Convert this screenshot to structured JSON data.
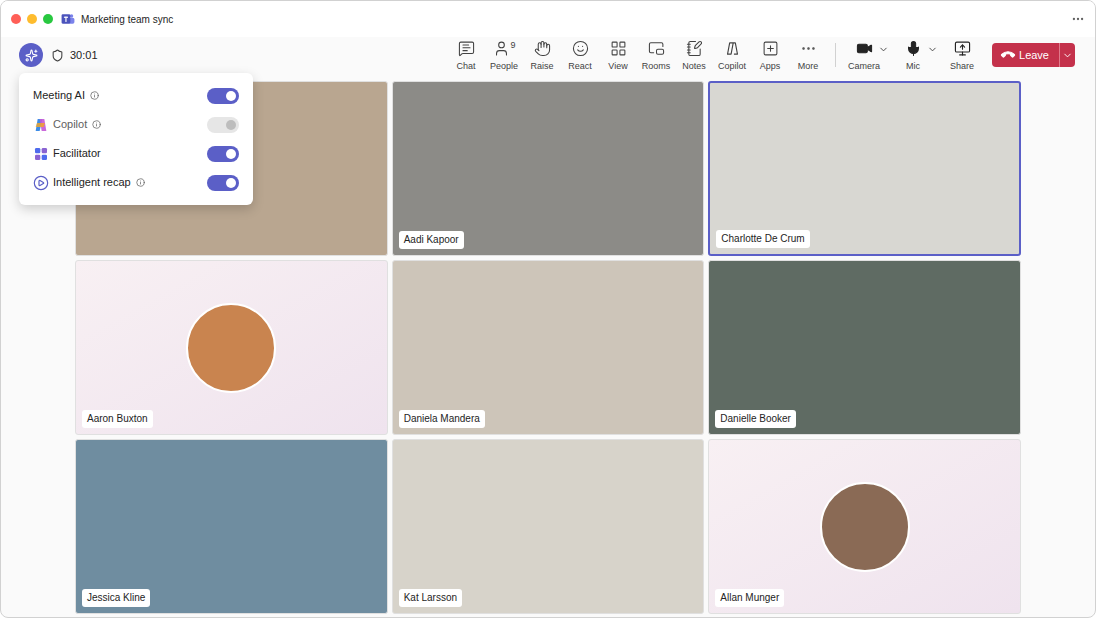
{
  "window": {
    "title": "Marketing team sync"
  },
  "meeting": {
    "timer": "30:01"
  },
  "toolbar": [
    {
      "label": "Chat"
    },
    {
      "label": "People",
      "count": "9"
    },
    {
      "label": "Raise"
    },
    {
      "label": "React"
    },
    {
      "label": "View"
    },
    {
      "label": "Rooms"
    },
    {
      "label": "Notes"
    },
    {
      "label": "Copilot"
    },
    {
      "label": "Apps"
    },
    {
      "label": "More"
    }
  ],
  "devices": [
    {
      "label": "Camera"
    },
    {
      "label": "Mic"
    }
  ],
  "share": {
    "label": "Share"
  },
  "leave": {
    "label": "Leave"
  },
  "ai_menu": [
    {
      "label": "Meeting AI",
      "info": true,
      "on": true,
      "disabled": false
    },
    {
      "label": "Copilot",
      "info": true,
      "on": true,
      "disabled": true
    },
    {
      "label": "Facilitator",
      "info": false,
      "on": true,
      "disabled": false
    },
    {
      "label": "Intelligent recap",
      "info": true,
      "on": true,
      "disabled": false
    }
  ],
  "participants": [
    {
      "name": "",
      "kind": "video",
      "speaking": false,
      "color": "#b9a690"
    },
    {
      "name": "Aadi Kapoor",
      "kind": "video",
      "speaking": false,
      "color": "#8c8b87"
    },
    {
      "name": "Charlotte De Crum",
      "kind": "video",
      "speaking": true,
      "color": "#d8d7d2"
    },
    {
      "name": "Aaron Buxton",
      "kind": "avatar",
      "speaking": false,
      "color": "#c9844f"
    },
    {
      "name": "Daniela Mandera",
      "kind": "video",
      "speaking": false,
      "color": "#cdc5b9"
    },
    {
      "name": "Danielle Booker",
      "kind": "video",
      "speaking": false,
      "color": "#5f6b63"
    },
    {
      "name": "Jessica Kline",
      "kind": "video",
      "speaking": false,
      "color": "#6f8da0"
    },
    {
      "name": "Kat Larsson",
      "kind": "video",
      "speaking": false,
      "color": "#d7d3ca"
    },
    {
      "name": "Allan Munger",
      "kind": "avatar",
      "speaking": false,
      "color": "#8a6a55"
    }
  ]
}
